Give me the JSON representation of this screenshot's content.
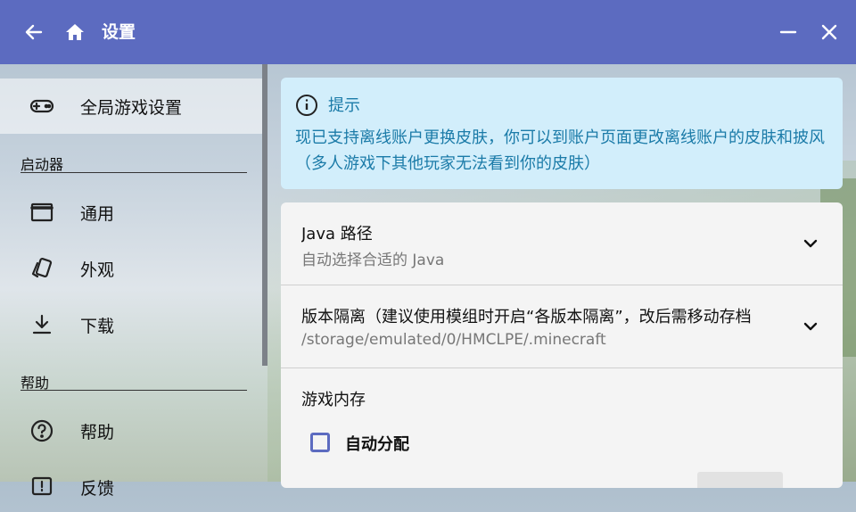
{
  "titlebar": {
    "title": "设置",
    "back_icon": "arrow-left-icon",
    "home_icon": "home-icon",
    "minimize_icon": "minimize-icon",
    "close_icon": "close-icon",
    "color": "#5c6bc0"
  },
  "sidebar": {
    "global": {
      "label": "全局游戏设置",
      "icon": "gamepad-icon"
    },
    "launcher_section": "启动器",
    "launcher_items": [
      {
        "label": "通用",
        "icon": "window-icon"
      },
      {
        "label": "外观",
        "icon": "cards-icon"
      },
      {
        "label": "下载",
        "icon": "download-icon"
      }
    ],
    "help_section": "帮助",
    "help_items": [
      {
        "label": "帮助",
        "icon": "help-circle-icon"
      },
      {
        "label": "反馈",
        "icon": "feedback-icon"
      }
    ]
  },
  "hint": {
    "icon": "info-icon",
    "title": "提示",
    "body": "现已支持离线账户更换皮肤，你可以到账户页面更改离线账户的皮肤和披风（多人游戏下其他玩家无法看到你的皮肤）",
    "bg_color": "#d2eefb",
    "text_color": "#1b7ba8"
  },
  "settings": {
    "java": {
      "title": "Java 路径",
      "subtitle": "自动选择合适的 Java"
    },
    "isolation": {
      "title": "版本隔离（建议使用模组时开启“各版本隔离”，改后需移动存档",
      "subtitle": "/storage/emulated/0/HMCLPE/.minecraft"
    },
    "memory": {
      "title": "游戏内存",
      "auto_label": "自动分配",
      "auto_checked": false
    }
  }
}
